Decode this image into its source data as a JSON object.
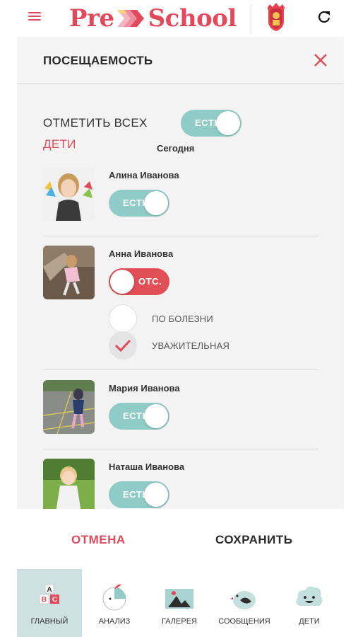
{
  "header": {
    "logo_pre": "Pre",
    "logo_school": "School"
  },
  "attendance": {
    "title": "ПОСЕЩАЕМОСТЬ",
    "mark_all_label": "ОТМЕТИТЬ ВСЕХ",
    "mark_all_toggle": "ЕСТЬ",
    "kids_label": "ДЕТИ",
    "date_label": "Сегодня",
    "children": [
      {
        "name": "Алина Иванова",
        "status": "ЕСТЬ",
        "present": true
      },
      {
        "name": "Анна Иванова",
        "status": "ОТС.",
        "present": false,
        "reasons": [
          {
            "label": "ПО БОЛЕЗНИ",
            "checked": false
          },
          {
            "label": "УВАЖИТЕЛЬНАЯ",
            "checked": true
          }
        ]
      },
      {
        "name": "Мария Иванова",
        "status": "ЕСТЬ",
        "present": true
      },
      {
        "name": "Наташа Иванова",
        "status": "ЕСТЬ",
        "present": true
      }
    ]
  },
  "actions": {
    "cancel": "ОТМЕНА",
    "save": "СОХРАНИТЬ"
  },
  "nav": {
    "items": [
      {
        "label": "ГЛАВНЫЙ",
        "icon": "abc-blocks-icon",
        "active": true
      },
      {
        "label": "АНАЛИЗ",
        "icon": "apple-icon",
        "active": false
      },
      {
        "label": "ГАЛЕРЕЯ",
        "icon": "picture-icon",
        "active": false
      },
      {
        "label": "СООБЩЕНИЯ",
        "icon": "bird-icon",
        "active": false
      },
      {
        "label": "ДЕТИ",
        "icon": "smiling-cloud-icon",
        "active": false
      }
    ],
    "block_letters": {
      "a": "A",
      "b": "B",
      "c": "C"
    }
  },
  "colors": {
    "accent": "#e2495a",
    "toggle_on": "#8fcbc7",
    "toggle_off": "#e04e56",
    "nav_active": "#cfe0e3"
  }
}
